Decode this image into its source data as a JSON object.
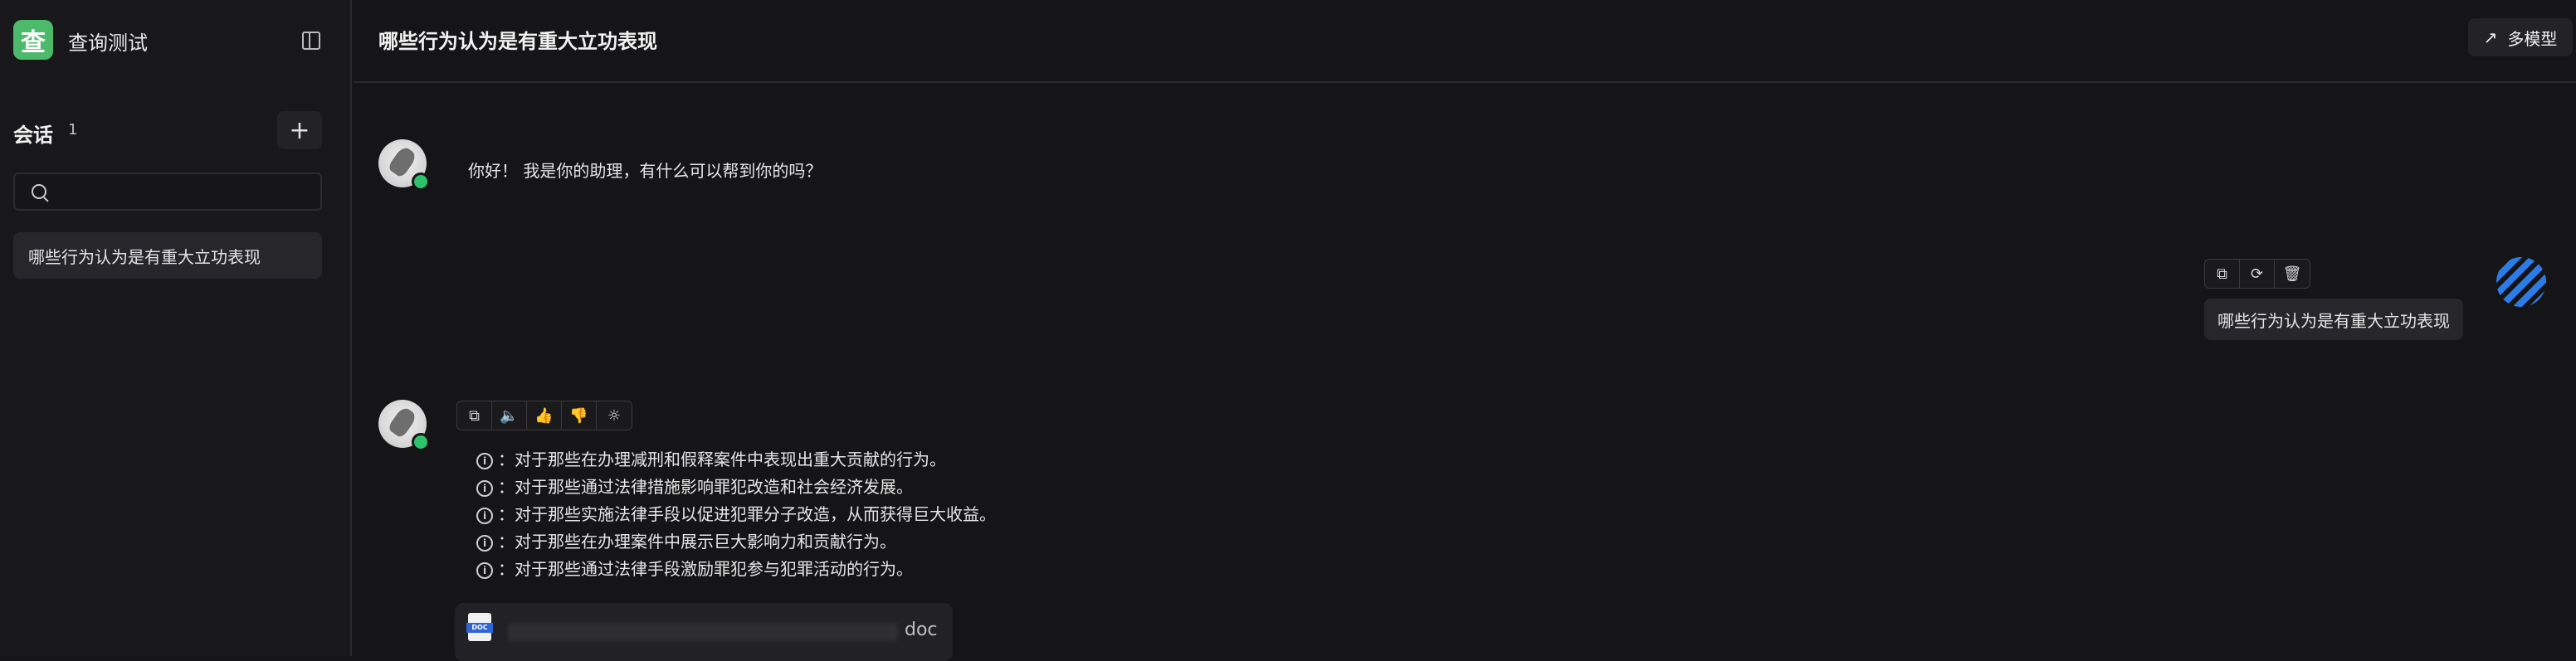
{
  "app": {
    "logo_char": "查",
    "title": "查询测试"
  },
  "sidebar": {
    "section_title": "会话",
    "session_count": "1",
    "add_label": "+",
    "search_placeholder": "",
    "conversations": [
      {
        "label": "哪些行为认为是有重大立功表现"
      }
    ]
  },
  "header": {
    "title": "哪些行为认为是有重大立功表现",
    "multi_model_label": "多模型"
  },
  "messages": [
    {
      "role": "assistant",
      "text": "你好！ 我是你的助理，有什么可以帮到你的吗？"
    },
    {
      "role": "user",
      "text": "哪些行为认为是有重大立功表现",
      "actions": [
        "copy-icon",
        "refresh-icon",
        "delete-icon"
      ]
    },
    {
      "role": "assistant",
      "actions": [
        "copy-icon",
        "speaker-icon",
        "thumbs-up-icon",
        "thumbs-down-icon",
        "lightbulb-icon"
      ],
      "items": [
        "对于那些在办理减刑和假释案件中表现出重大贡献的行为。",
        "对于那些通过法律措施影响罪犯改造和社会经济发展。",
        "对于那些实施法律手段以促进犯罪分子改造，从而获得巨大收益。",
        "对于那些在办理案件中展示巨大影响力和贡献行为。",
        "对于那些通过法律手段激励罪犯参与犯罪活动的行为。"
      ],
      "item_icon_char": "i",
      "item_separator": "：",
      "attachment": {
        "ext": "doc",
        "badge": "DOC"
      }
    }
  ],
  "colors": {
    "accent_green": "#4cba6b",
    "online": "#2dc36a",
    "user_avatar": "#2d7be6",
    "background": "#151517"
  }
}
